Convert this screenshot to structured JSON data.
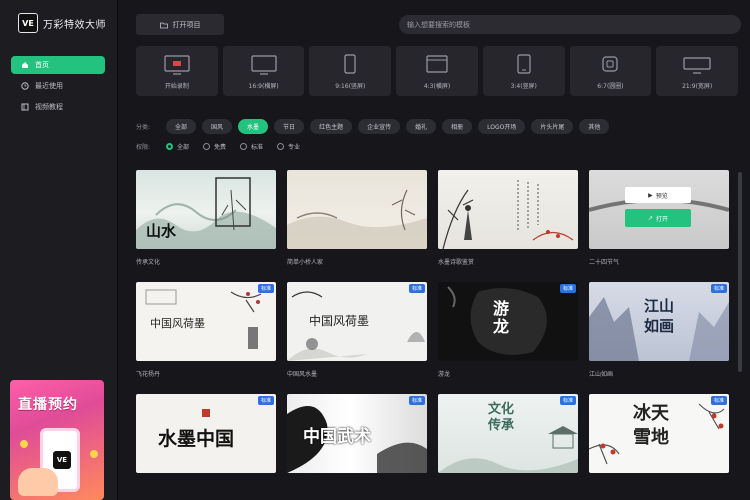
{
  "app": {
    "logo_text": "VE",
    "name": "万彩特效大师"
  },
  "sidebar": {
    "items": [
      {
        "label": "首页",
        "icon": "home-icon",
        "active": true
      },
      {
        "label": "最近使用",
        "icon": "clock-icon",
        "active": false
      },
      {
        "label": "视频教程",
        "icon": "book-icon",
        "active": false
      }
    ],
    "promo": {
      "title": "直播预约",
      "logo_text": "VE"
    }
  },
  "toolbar": {
    "open_project_label": "打开项目"
  },
  "search": {
    "placeholder": "输入想要搜索的模板"
  },
  "ratios": [
    {
      "label": "开始录制"
    },
    {
      "label": "16:9(横屏)"
    },
    {
      "label": "9:16(竖屏)"
    },
    {
      "label": "4:3(横屏)"
    },
    {
      "label": "3:4(竖屏)"
    },
    {
      "label": "6:7(圆圈)"
    },
    {
      "label": "21:9(宽屏)"
    }
  ],
  "filters": {
    "category_label": "分类:",
    "categories": [
      "全部",
      "国风",
      "水墨",
      "节日",
      "红色主题",
      "企业宣传",
      "婚礼",
      "相册",
      "LOGO开场",
      "片头片尾",
      "其他"
    ],
    "active_category": "水墨",
    "price_label": "权限:",
    "prices": [
      "全部",
      "免费",
      "标准",
      "专业"
    ],
    "active_price": "全部"
  },
  "templates": [
    {
      "title": "传承文化",
      "art": "山水",
      "badge": ""
    },
    {
      "title": "简单小桥人家",
      "art": "",
      "badge": ""
    },
    {
      "title": "水墨诗歌鉴赏",
      "art": "",
      "badge": ""
    },
    {
      "title": "二十四节气",
      "art": "",
      "badge": "",
      "hover": {
        "preview": "预览",
        "open": "打开"
      }
    },
    {
      "title": "飞花杨丹",
      "art": "中国风荷墨",
      "badge": "标准"
    },
    {
      "title": "中国风水墨",
      "art": "中国风荷墨",
      "badge": "标准"
    },
    {
      "title": "游龙",
      "art": "游龙",
      "badge": "标准"
    },
    {
      "title": "江山如画",
      "art": "江山如画",
      "badge": "标准"
    },
    {
      "title": "",
      "art": "水墨中国",
      "badge": "标准"
    },
    {
      "title": "",
      "art": "中国武术",
      "badge": "标准"
    },
    {
      "title": "",
      "art": "文化传承",
      "badge": "标准"
    },
    {
      "title": "",
      "art": "冰天雪地",
      "badge": "标准"
    }
  ],
  "colors": {
    "accent": "#23c27e",
    "background": "#17171b",
    "sidebar": "#1c1c21",
    "badge": "#2f6fe0"
  }
}
